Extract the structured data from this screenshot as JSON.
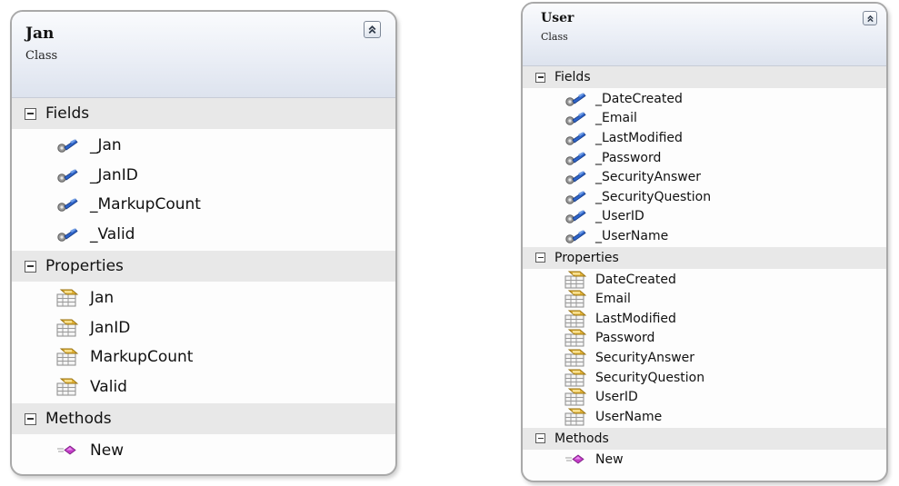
{
  "colors": {
    "field_icon_blue": "#2d63c8",
    "field_icon_grey": "#8a8a8a",
    "property_icon_gold": "#e2b33a",
    "method_icon_magenta": "#c23bc6",
    "border": "#a9a9a9",
    "header_gradient": "#e4e9f2"
  },
  "boxes": [
    {
      "name": "Jan",
      "stereotype": "Class",
      "collapse_icon": "double-chevron-up-icon",
      "sections": [
        {
          "title": "Fields",
          "icon": "field-icon",
          "items": [
            "_Jan",
            "_JanID",
            "_MarkupCount",
            "_Valid"
          ]
        },
        {
          "title": "Properties",
          "icon": "property-icon",
          "items": [
            "Jan",
            "JanID",
            "MarkupCount",
            "Valid"
          ]
        },
        {
          "title": "Methods",
          "icon": "method-icon",
          "items": [
            "New"
          ]
        }
      ]
    },
    {
      "name": "User",
      "stereotype": "Class",
      "collapse_icon": "double-chevron-up-icon",
      "sections": [
        {
          "title": "Fields",
          "icon": "field-icon",
          "items": [
            "_DateCreated",
            "_Email",
            "_LastModified",
            "_Password",
            "_SecurityAnswer",
            "_SecurityQuestion",
            "_UserID",
            "_UserName"
          ]
        },
        {
          "title": "Properties",
          "icon": "property-icon",
          "items": [
            "DateCreated",
            "Email",
            "LastModified",
            "Password",
            "SecurityAnswer",
            "SecurityQuestion",
            "UserID",
            "UserName"
          ]
        },
        {
          "title": "Methods",
          "icon": "method-icon",
          "items": [
            "New"
          ]
        }
      ]
    }
  ]
}
